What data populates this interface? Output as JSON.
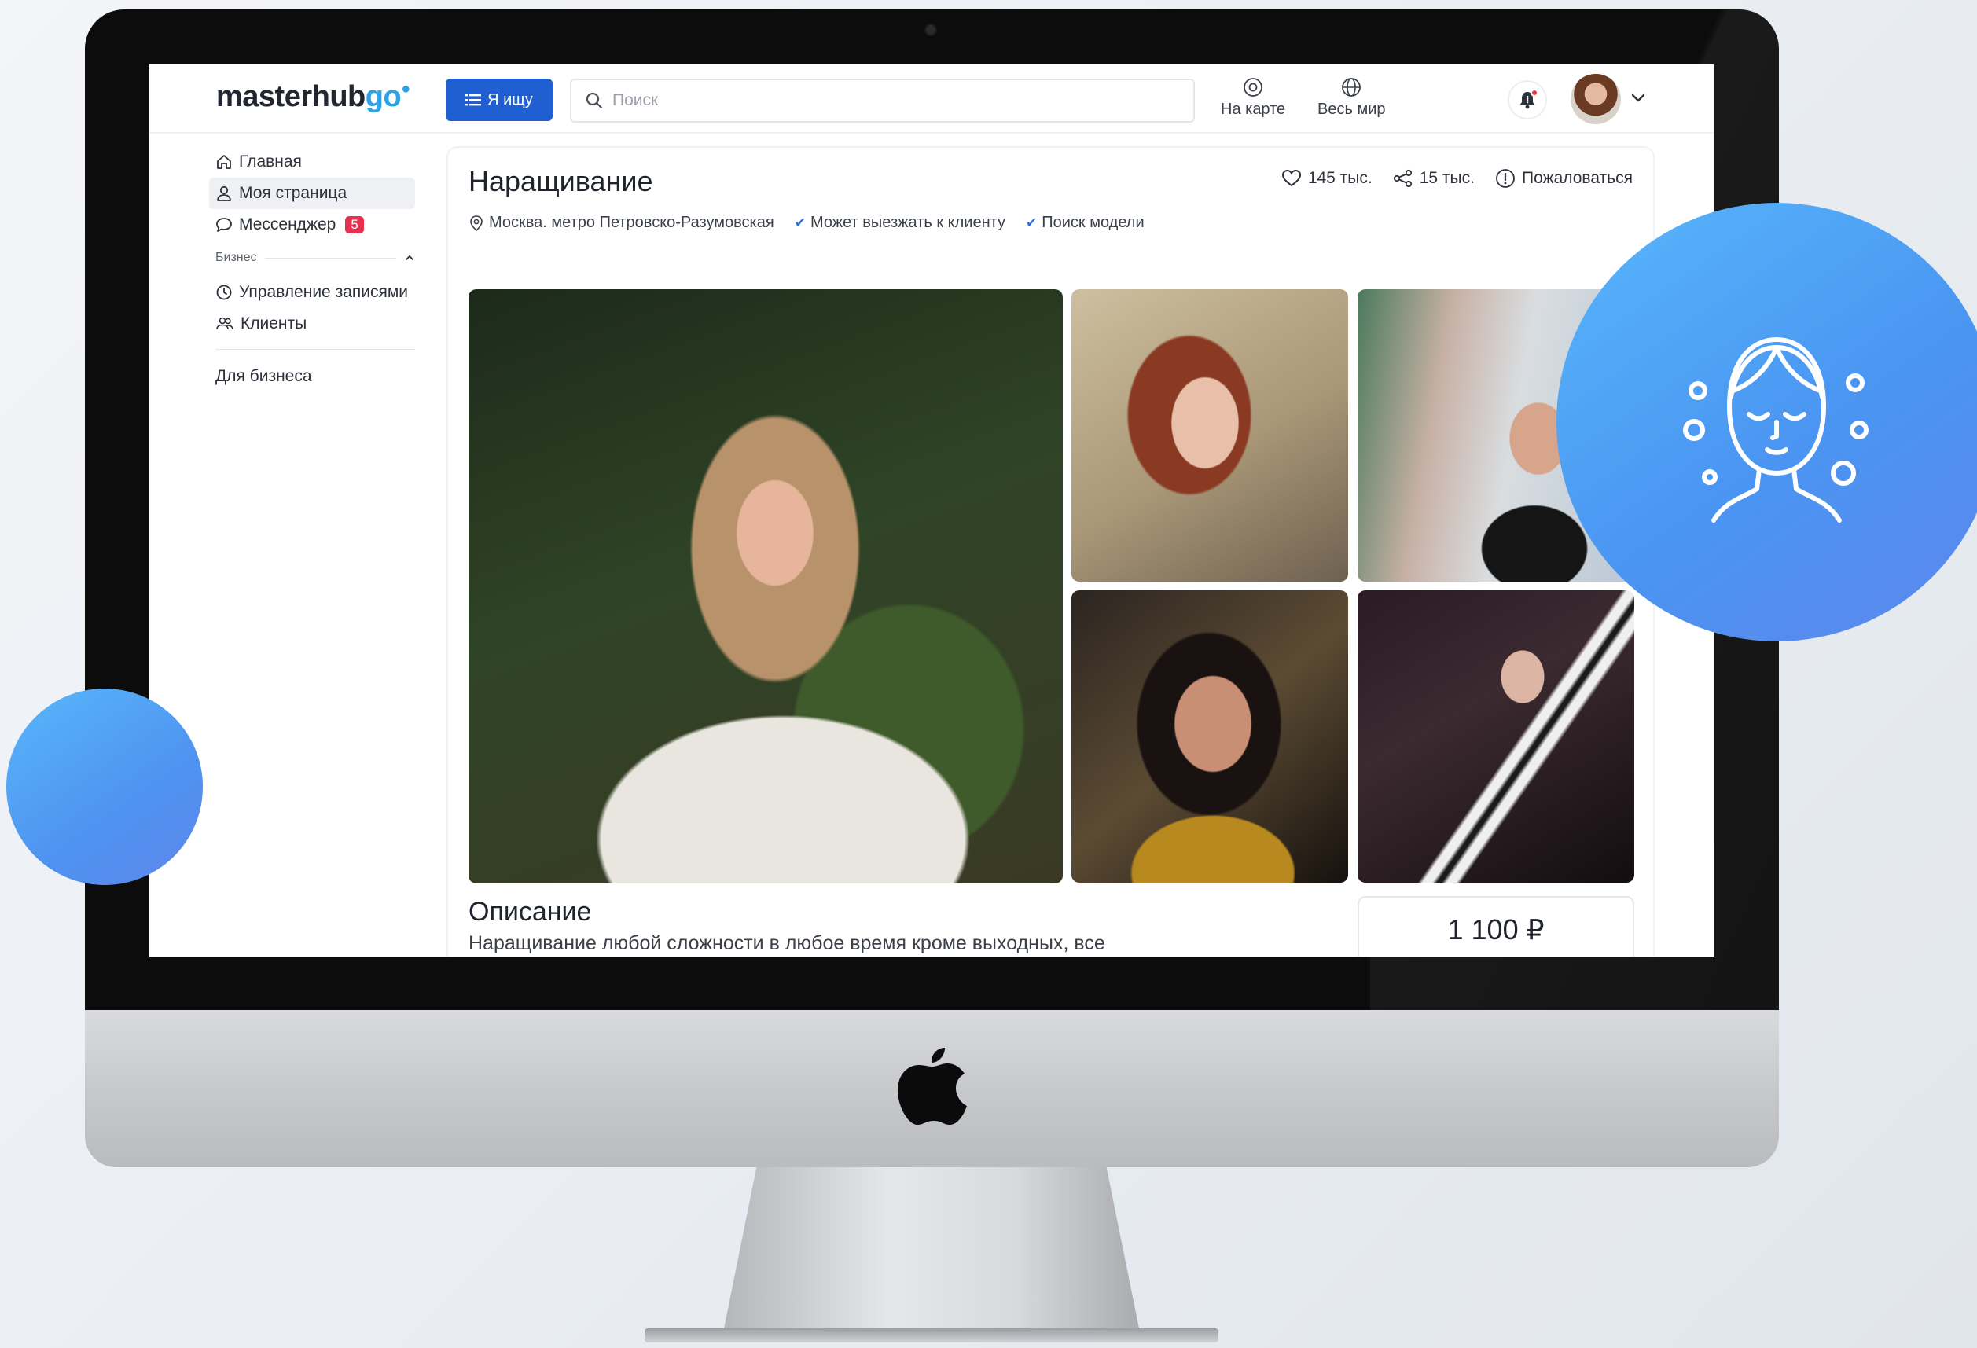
{
  "topbar": {
    "logo_main": "masterhub",
    "logo_accent": "go",
    "seek_label": "Я ищу",
    "search_placeholder": "Поиск",
    "map_label": "На карте",
    "world_label": "Весь мир"
  },
  "sidebar": {
    "items": [
      {
        "label": "Главная",
        "icon": "home-icon"
      },
      {
        "label": "Моя страница",
        "icon": "user-icon",
        "active": true
      },
      {
        "label": "Мессенджер",
        "icon": "chat-icon",
        "badge": "5"
      }
    ],
    "section_label": "Бизнес",
    "business_items": [
      {
        "label": "Управление записями",
        "icon": "clock-icon"
      },
      {
        "label": "Клиенты",
        "icon": "users-icon"
      }
    ],
    "footer_link": "Для бизнеса"
  },
  "listing": {
    "title": "Наращивание",
    "likes": "145 тыс.",
    "shares": "15 тыс.",
    "report": "Пожаловаться",
    "location": "Москва. метро Петровско-Разумовская",
    "tags": [
      "Может выезжать к клиенту",
      "Поиск модели"
    ],
    "description_title": "Описание",
    "description_text": "Наращивание любой сложности в любое время кроме выходных, все",
    "price": "1 100 ₽"
  },
  "colors": {
    "brand_blue": "#1f5fd1",
    "logo_accent": "#2aa3e8",
    "badge_red": "#e53150",
    "deco_circle": "#4a95f2"
  }
}
